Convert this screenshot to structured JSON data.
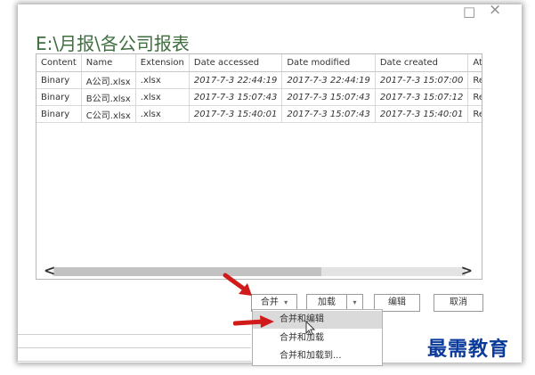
{
  "window": {
    "title": "E:\\月报\\各公司报表",
    "maximize_icon": "□",
    "close_icon": "×"
  },
  "grid": {
    "columns": [
      "Content",
      "Name",
      "Extension",
      "Date accessed",
      "Date modified",
      "Date created",
      "Attribu"
    ],
    "rows": [
      [
        "Binary",
        "A公司.xlsx",
        ".xlsx",
        "2017-7-3 22:44:19",
        "2017-7-3 22:44:19",
        "2017-7-3 15:07:00",
        "Record"
      ],
      [
        "Binary",
        "B公司.xlsx",
        ".xlsx",
        "2017-7-3 15:07:43",
        "2017-7-3 15:07:43",
        "2017-7-3 15:07:12",
        "Record"
      ],
      [
        "Binary",
        "C公司.xlsx",
        ".xlsx",
        "2017-7-3 15:40:01",
        "2017-7-3 15:07:43",
        "2017-7-3 15:40:01",
        "Record"
      ]
    ]
  },
  "scrollbar": {
    "left_arrow": "<",
    "right_arrow": ">"
  },
  "buttons": {
    "combine": "合并",
    "combine_caret": "▾",
    "load": "加载",
    "load_caret": "▾",
    "edit": "编辑",
    "cancel": "取消"
  },
  "combine_menu": {
    "items": [
      "合并和编辑",
      "合并和加载",
      "合并和加载到..."
    ]
  },
  "watermark": "最需教育",
  "colors": {
    "title": "#3f6e3f",
    "arrow": "#d11a1a",
    "menu_highlight": "#dadada",
    "watermark": "#0a3a9a"
  }
}
